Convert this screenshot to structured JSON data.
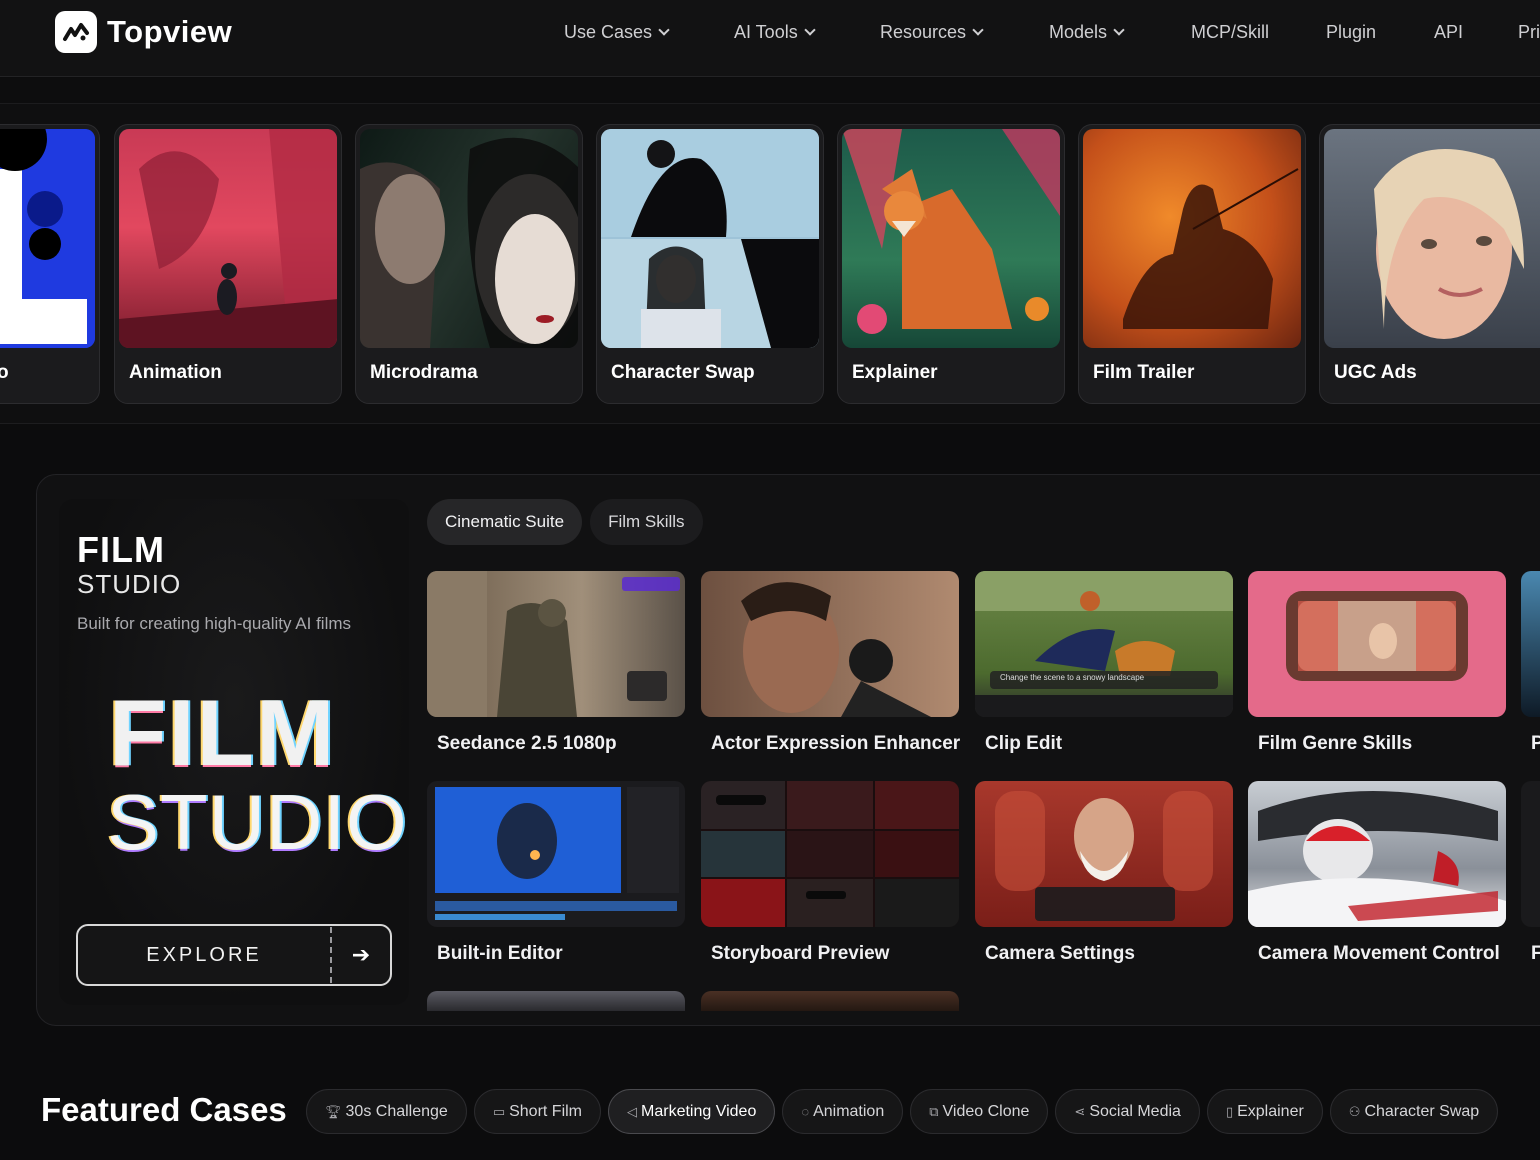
{
  "nav": {
    "brand": "Topview",
    "items": [
      {
        "label": "Use Cases",
        "dropdown": true
      },
      {
        "label": "AI Tools",
        "dropdown": true
      },
      {
        "label": "Resources",
        "dropdown": true
      },
      {
        "label": "Models",
        "dropdown": true
      },
      {
        "label": "MCP/Skill",
        "dropdown": false
      },
      {
        "label": "Plugin",
        "dropdown": false
      },
      {
        "label": "API",
        "dropdown": false
      },
      {
        "label": "Pri",
        "dropdown": false
      }
    ]
  },
  "use_cases": [
    {
      "label": "o"
    },
    {
      "label": "Animation"
    },
    {
      "label": "Microdrama"
    },
    {
      "label": "Character Swap"
    },
    {
      "label": "Explainer"
    },
    {
      "label": "Film Trailer"
    },
    {
      "label": "UGC Ads"
    }
  ],
  "studio": {
    "title": "FILM",
    "subtitle": "STUDIO",
    "description": "Built for creating high-quality AI films",
    "art_line1": "FILM",
    "art_line2": "STUDIO",
    "explore_label": "EXPLORE",
    "tabs": [
      {
        "label": "Cinematic Suite",
        "active": true
      },
      {
        "label": "Film Skills",
        "active": false
      }
    ],
    "tools": [
      {
        "label": "Seedance 2.5 1080p"
      },
      {
        "label": "Actor Expression Enhancer"
      },
      {
        "label": "Clip Edit"
      },
      {
        "label": "Film Genre Skills"
      },
      {
        "label": "P"
      },
      {
        "label": "Built-in Editor"
      },
      {
        "label": "Storyboard Preview"
      },
      {
        "label": "Camera Settings"
      },
      {
        "label": "Camera Movement Control"
      },
      {
        "label": "F"
      }
    ],
    "clip_edit_prompt": "Change the scene to a snowy landscape"
  },
  "featured": {
    "title": "Featured Cases",
    "pills": [
      {
        "label": "30s Challenge",
        "icon": "trophy-icon",
        "active": false
      },
      {
        "label": "Short Film",
        "icon": "clapper-icon",
        "active": false
      },
      {
        "label": "Marketing Video",
        "icon": "megaphone-icon",
        "active": true
      },
      {
        "label": "Animation",
        "icon": "palette-icon",
        "active": false
      },
      {
        "label": "Video Clone",
        "icon": "copy-icon",
        "active": false
      },
      {
        "label": "Social Media",
        "icon": "share-icon",
        "active": false
      },
      {
        "label": "Explainer",
        "icon": "book-icon",
        "active": false
      },
      {
        "label": "Character Swap",
        "icon": "user-icon",
        "active": false
      }
    ]
  }
}
